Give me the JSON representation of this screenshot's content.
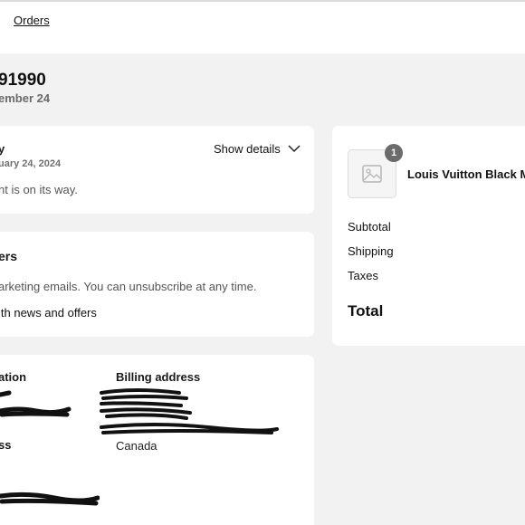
{
  "header": {
    "orders_link": "Orders"
  },
  "order": {
    "number": "91990",
    "date": "ember 24"
  },
  "status_card": {
    "title": "y",
    "date": "uary 24, 2024",
    "message": "nt is on its way.",
    "show_details": "Show details"
  },
  "news_card": {
    "title": "ers",
    "text": "arketing emails. You can unsubscribe at any time.",
    "checkbox_label": "ith news and offers"
  },
  "info_card": {
    "col1_title": "ation",
    "col2_title": "Billing address",
    "col1_address_title": "ss",
    "billing_country": "Canada"
  },
  "summary": {
    "product_name": "Louis Vuitton Black Mal",
    "quantity": "1",
    "subtotal_label": "Subtotal",
    "shipping_label": "Shipping",
    "taxes_label": "Taxes",
    "total_label": "Total"
  },
  "icons": {
    "chevron": "chevron-down-icon",
    "image": "image-placeholder-icon"
  }
}
